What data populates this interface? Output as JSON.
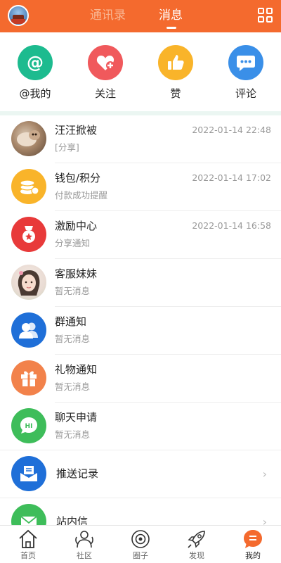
{
  "header": {
    "tabs": [
      {
        "label": "通讯录",
        "active": false
      },
      {
        "label": "消息",
        "active": true
      }
    ],
    "accent_color": "#f46a2e"
  },
  "quick_actions": [
    {
      "label": "@我的",
      "icon": "at-icon",
      "color": "#1dbb8f"
    },
    {
      "label": "关注",
      "icon": "heart-plus-icon",
      "color": "#f0595c"
    },
    {
      "label": "赞",
      "icon": "thumbs-up-icon",
      "color": "#f9b42a"
    },
    {
      "label": "评论",
      "icon": "chat-bubble-icon",
      "color": "#3a8fe8"
    }
  ],
  "messages": [
    {
      "title": "汪汪掀被",
      "subtitle": "[分享]",
      "time": "2022-01-14 22:48",
      "icon": "user-photo-avatar"
    },
    {
      "title": "钱包/积分",
      "subtitle": "付款成功提醒",
      "time": "2022-01-14 17:02",
      "icon": "coins-icon"
    },
    {
      "title": "激励中心",
      "subtitle": "分享通知",
      "time": "2022-01-14 16:58",
      "icon": "medal-icon"
    },
    {
      "title": "客服妹妹",
      "subtitle": "暂无消息",
      "time": "",
      "icon": "support-photo-avatar"
    },
    {
      "title": "群通知",
      "subtitle": "暂无消息",
      "time": "",
      "icon": "group-icon"
    },
    {
      "title": "礼物通知",
      "subtitle": "暂无消息",
      "time": "",
      "icon": "gift-icon"
    },
    {
      "title": "聊天申请",
      "subtitle": "暂无消息",
      "time": "",
      "icon": "hi-chat-icon"
    }
  ],
  "links": [
    {
      "title": "推送记录",
      "icon": "push-inbox-icon"
    },
    {
      "title": "站内信",
      "icon": "mail-icon"
    }
  ],
  "bottom_nav": [
    {
      "label": "首页",
      "icon": "home-icon",
      "active": false
    },
    {
      "label": "社区",
      "icon": "community-icon",
      "active": false
    },
    {
      "label": "圈子",
      "icon": "circle-icon",
      "active": false
    },
    {
      "label": "发现",
      "icon": "rocket-icon",
      "active": false
    },
    {
      "label": "我的",
      "icon": "profile-icon",
      "active": true
    }
  ]
}
